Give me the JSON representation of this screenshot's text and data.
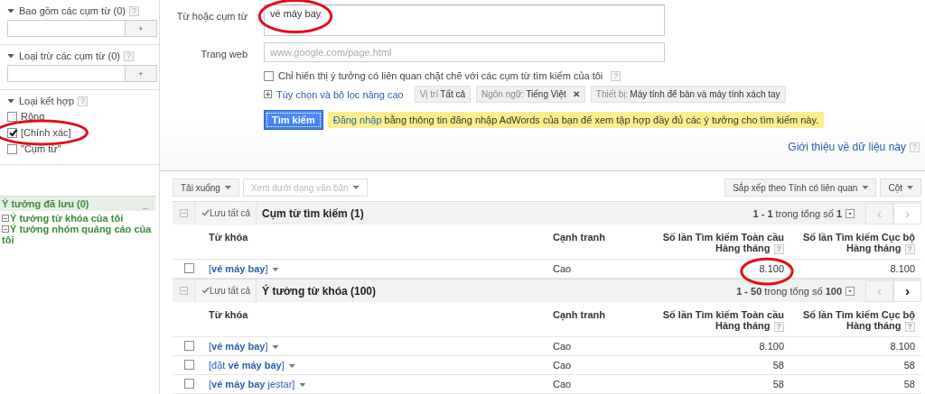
{
  "sidebar": {
    "include": {
      "title": "Bao gồm các cụm từ (0)",
      "help": "?",
      "add": "+"
    },
    "exclude": {
      "title": "Loại trừ các cụm từ (0)",
      "help": "?",
      "add": "+"
    },
    "match_types": {
      "title": "Loại kết hợp",
      "help": "?",
      "options": [
        {
          "label": "Rộng",
          "checked": false,
          "circled": false
        },
        {
          "label": "[Chính xác]",
          "checked": true,
          "circled": true
        },
        {
          "label": "\"Cụm từ\"",
          "checked": false,
          "circled": false
        }
      ]
    },
    "saved": {
      "title": "Ý tưởng đã lưu (0)",
      "collapse": "_",
      "items": [
        "Ý tưởng từ khóa của tôi",
        "Ý tưởng nhóm quảng cáo của tôi"
      ]
    }
  },
  "search": {
    "keyword_label": "Từ hoặc cụm từ",
    "keyword_value": "vé máy bay",
    "keyword_circled": true,
    "website_label": "Trang web",
    "website_placeholder": "www.google.com/page.html",
    "close_only": {
      "label": "Chỉ hiển thị ý tưởng có liên quan chặt chẽ với các cụm từ tìm kiếm của tôi",
      "checked": false,
      "help": "?"
    },
    "advanced_link": "Tùy chọn và bộ lọc nâng cao",
    "filters": [
      {
        "label": "Vị trí",
        "value": "Tất cả"
      },
      {
        "label": "Ngôn ngữ:",
        "value": "Tiếng Việt",
        "remove": "✕"
      },
      {
        "label": "Thiết bị:",
        "value": "Máy tính để bàn và máy tính xách tay"
      }
    ],
    "search_button": "Tìm kiếm",
    "notice": {
      "link": "Đăng nhập",
      "text": "bằng thông tin đăng nhập AdWords của bạn để xem tập hợp đầy đủ các ý tưởng cho tìm kiếm này."
    },
    "about_link": "Giới thiệu về dữ liệu này",
    "about_help": "?"
  },
  "toolbar": {
    "download": "Tải xuống",
    "view_text": {
      "label": "Xem dưới dạng văn bản",
      "disabled": true
    },
    "sort": "Sắp xếp theo Tính có liên quan",
    "columns": "Cột"
  },
  "groups": [
    {
      "save_all": "Lưu tất cả",
      "title": "Cụm từ tìm kiếm (1)",
      "range": "**1 - 1** trong tổng số **1**",
      "prev": {
        "label": "‹",
        "disabled": true
      },
      "next": {
        "label": "›",
        "disabled": true
      },
      "columns": [
        {
          "label": "Từ khóa"
        },
        {
          "label": "Cạnh tranh"
        },
        {
          "label": "Số lần Tìm kiếm Toàn cầu Hàng tháng",
          "help": "?"
        },
        {
          "label": "Số lần Tìm kiếm Cục bộ Hàng tháng",
          "help": "?"
        }
      ],
      "rows": [
        {
          "keyword": "[**vé máy bay**]",
          "competition": "Cao",
          "global": "8.100",
          "local": "8.100",
          "checked": false,
          "global_circled": true
        }
      ]
    },
    {
      "save_all": "Lưu tất cả",
      "title": "Ý tưởng từ khóa (100)",
      "range": "**1 - 50** trong tổng số **100**",
      "prev": {
        "label": "‹",
        "disabled": true
      },
      "next": {
        "label": "›",
        "disabled": false
      },
      "columns": [
        {
          "label": "Từ khóa"
        },
        {
          "label": "Cạnh tranh"
        },
        {
          "label": "Số lần Tìm kiếm Toàn cầu Hàng tháng",
          "help": "?"
        },
        {
          "label": "Số lần Tìm kiếm Cục bộ Hàng tháng",
          "help": "?"
        }
      ],
      "rows": [
        {
          "keyword": "[**vé máy bay**]",
          "competition": "Cao",
          "global": "8.100",
          "local": "8.100",
          "checked": false,
          "global_circled": false
        },
        {
          "keyword": "[đặt **vé máy bay**]",
          "competition": "Cao",
          "global": "58",
          "local": "58",
          "checked": false,
          "global_circled": false
        },
        {
          "keyword": "[**vé máy bay** jestar]",
          "competition": "Cao",
          "global": "58",
          "local": "58",
          "checked": false,
          "global_circled": false
        }
      ]
    }
  ]
}
